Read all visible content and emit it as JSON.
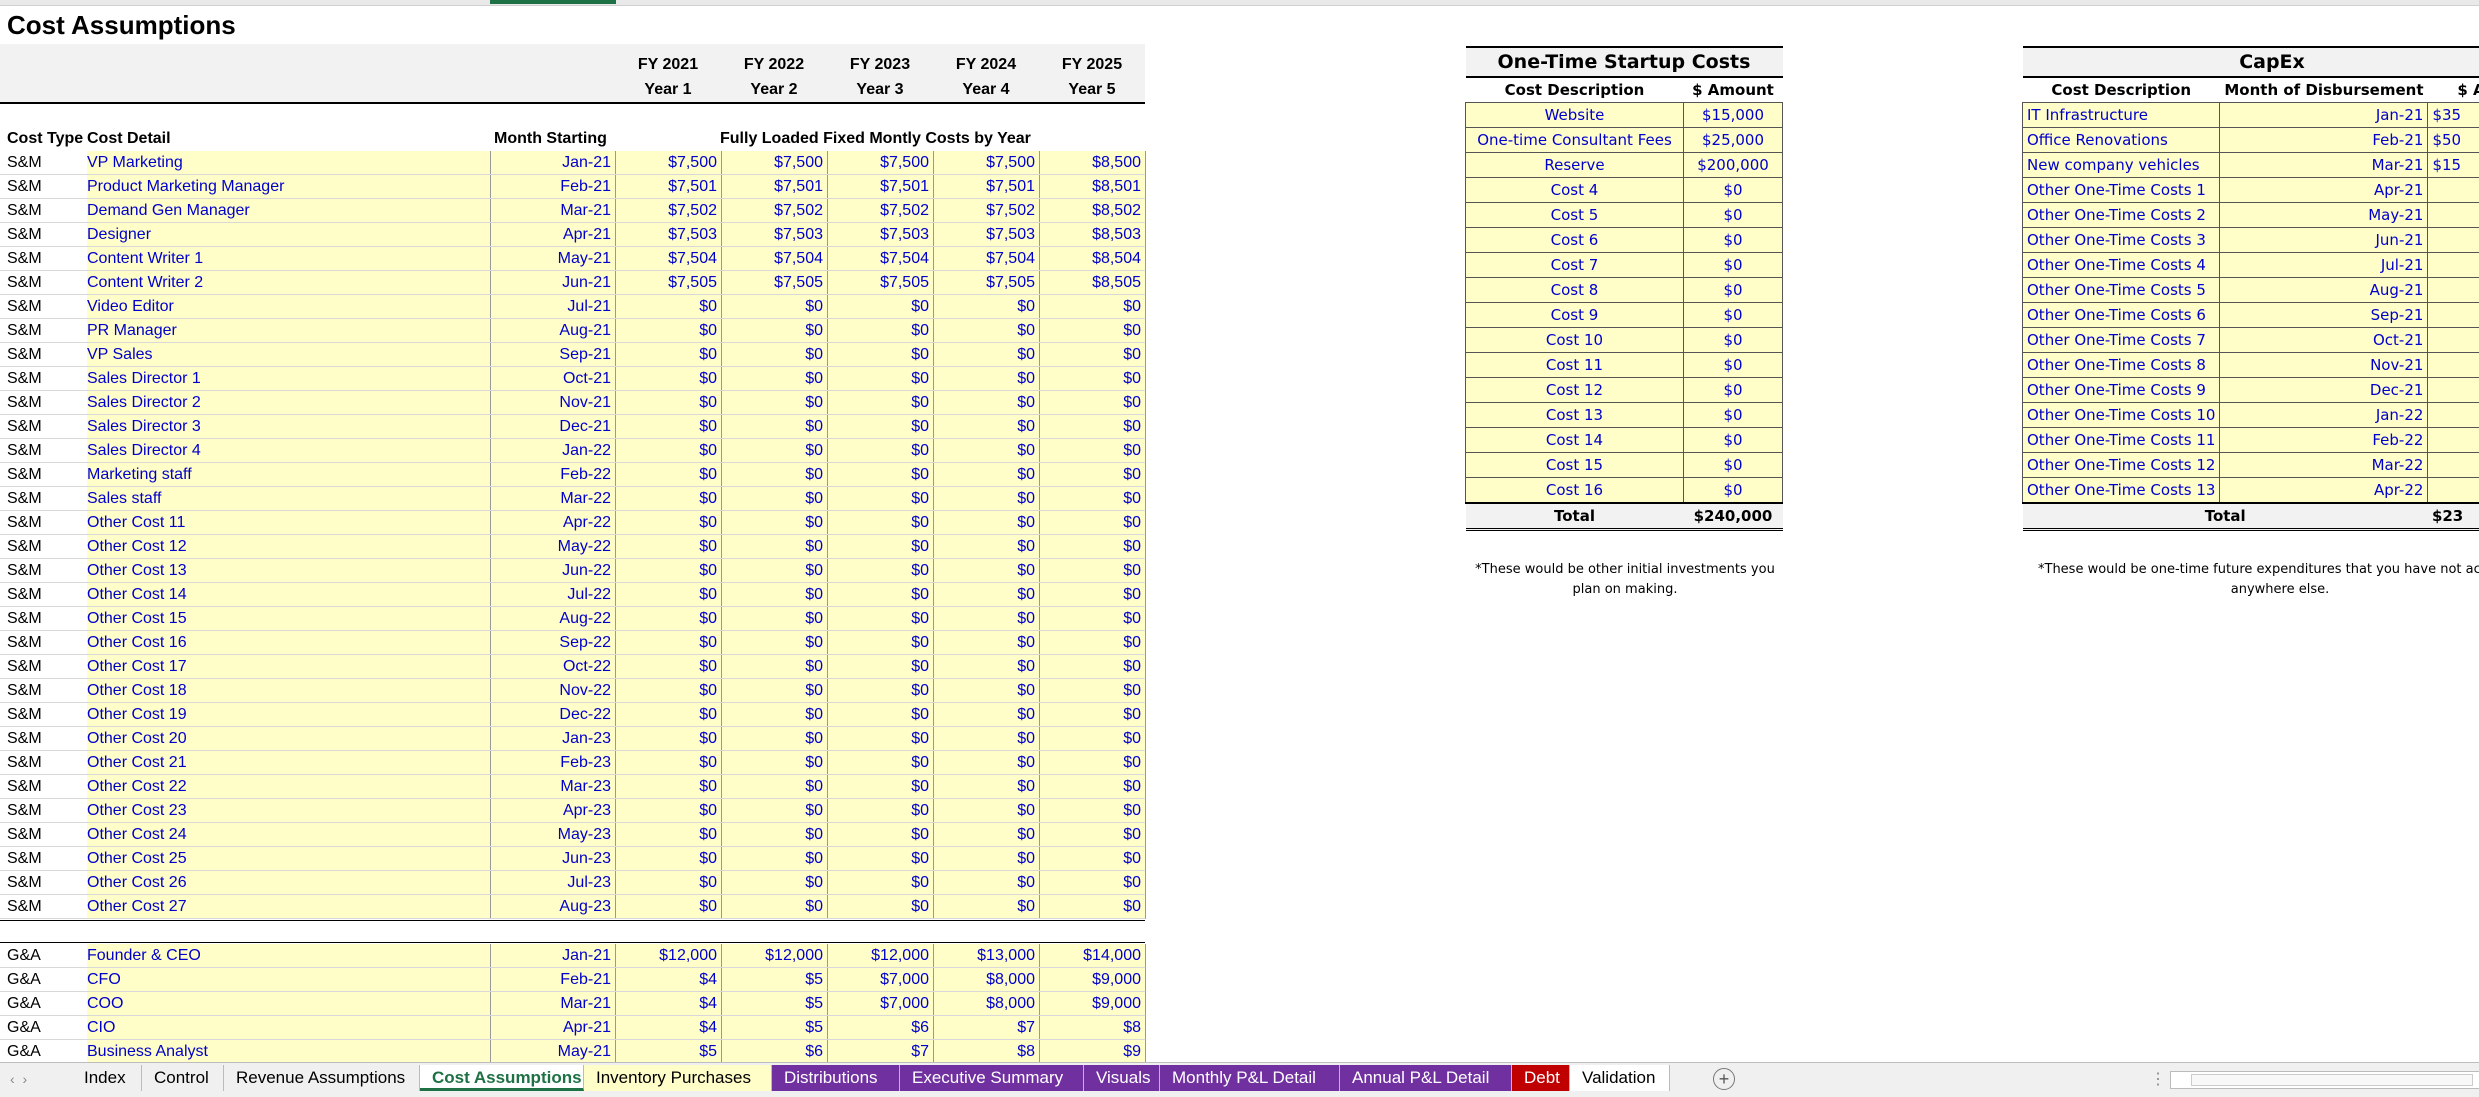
{
  "sheet_title": "Cost Assumptions",
  "fy_headers": [
    {
      "fy": "FY 2021",
      "year": "Year 1"
    },
    {
      "fy": "FY 2022",
      "year": "Year 2"
    },
    {
      "fy": "FY 2023",
      "year": "Year 3"
    },
    {
      "fy": "FY 2024",
      "year": "Year 4"
    },
    {
      "fy": "FY 2025",
      "year": "Year 5"
    }
  ],
  "column_headers": {
    "cost_type": "Cost Type",
    "cost_detail": "Cost Detail",
    "month_starting": "Month Starting",
    "fixed_costs": "Fully Loaded Fixed Montly Costs by Year"
  },
  "sm_rows": [
    {
      "type": "S&M",
      "detail": "VP Marketing",
      "month": "Jan-21",
      "values": [
        "$7,500",
        "$7,500",
        "$7,500",
        "$7,500",
        "$8,500"
      ]
    },
    {
      "type": "S&M",
      "detail": "Product Marketing Manager",
      "month": "Feb-21",
      "values": [
        "$7,501",
        "$7,501",
        "$7,501",
        "$7,501",
        "$8,501"
      ]
    },
    {
      "type": "S&M",
      "detail": "Demand Gen Manager",
      "month": "Mar-21",
      "values": [
        "$7,502",
        "$7,502",
        "$7,502",
        "$7,502",
        "$8,502"
      ]
    },
    {
      "type": "S&M",
      "detail": "Designer",
      "month": "Apr-21",
      "values": [
        "$7,503",
        "$7,503",
        "$7,503",
        "$7,503",
        "$8,503"
      ]
    },
    {
      "type": "S&M",
      "detail": "Content Writer 1",
      "month": "May-21",
      "values": [
        "$7,504",
        "$7,504",
        "$7,504",
        "$7,504",
        "$8,504"
      ]
    },
    {
      "type": "S&M",
      "detail": "Content Writer 2",
      "month": "Jun-21",
      "values": [
        "$7,505",
        "$7,505",
        "$7,505",
        "$7,505",
        "$8,505"
      ]
    },
    {
      "type": "S&M",
      "detail": "Video Editor",
      "month": "Jul-21",
      "values": [
        "$0",
        "$0",
        "$0",
        "$0",
        "$0"
      ]
    },
    {
      "type": "S&M",
      "detail": "PR Manager",
      "month": "Aug-21",
      "values": [
        "$0",
        "$0",
        "$0",
        "$0",
        "$0"
      ]
    },
    {
      "type": "S&M",
      "detail": "VP Sales",
      "month": "Sep-21",
      "values": [
        "$0",
        "$0",
        "$0",
        "$0",
        "$0"
      ]
    },
    {
      "type": "S&M",
      "detail": "Sales Director 1",
      "month": "Oct-21",
      "values": [
        "$0",
        "$0",
        "$0",
        "$0",
        "$0"
      ]
    },
    {
      "type": "S&M",
      "detail": "Sales Director 2",
      "month": "Nov-21",
      "values": [
        "$0",
        "$0",
        "$0",
        "$0",
        "$0"
      ]
    },
    {
      "type": "S&M",
      "detail": "Sales Director 3",
      "month": "Dec-21",
      "values": [
        "$0",
        "$0",
        "$0",
        "$0",
        "$0"
      ]
    },
    {
      "type": "S&M",
      "detail": "Sales Director 4",
      "month": "Jan-22",
      "values": [
        "$0",
        "$0",
        "$0",
        "$0",
        "$0"
      ]
    },
    {
      "type": "S&M",
      "detail": "Marketing staff",
      "month": "Feb-22",
      "values": [
        "$0",
        "$0",
        "$0",
        "$0",
        "$0"
      ]
    },
    {
      "type": "S&M",
      "detail": "Sales staff",
      "month": "Mar-22",
      "values": [
        "$0",
        "$0",
        "$0",
        "$0",
        "$0"
      ]
    },
    {
      "type": "S&M",
      "detail": "Other Cost 11",
      "month": "Apr-22",
      "values": [
        "$0",
        "$0",
        "$0",
        "$0",
        "$0"
      ]
    },
    {
      "type": "S&M",
      "detail": "Other Cost 12",
      "month": "May-22",
      "values": [
        "$0",
        "$0",
        "$0",
        "$0",
        "$0"
      ]
    },
    {
      "type": "S&M",
      "detail": "Other Cost 13",
      "month": "Jun-22",
      "values": [
        "$0",
        "$0",
        "$0",
        "$0",
        "$0"
      ]
    },
    {
      "type": "S&M",
      "detail": "Other Cost 14",
      "month": "Jul-22",
      "values": [
        "$0",
        "$0",
        "$0",
        "$0",
        "$0"
      ]
    },
    {
      "type": "S&M",
      "detail": "Other Cost 15",
      "month": "Aug-22",
      "values": [
        "$0",
        "$0",
        "$0",
        "$0",
        "$0"
      ]
    },
    {
      "type": "S&M",
      "detail": "Other Cost 16",
      "month": "Sep-22",
      "values": [
        "$0",
        "$0",
        "$0",
        "$0",
        "$0"
      ]
    },
    {
      "type": "S&M",
      "detail": "Other Cost 17",
      "month": "Oct-22",
      "values": [
        "$0",
        "$0",
        "$0",
        "$0",
        "$0"
      ]
    },
    {
      "type": "S&M",
      "detail": "Other Cost 18",
      "month": "Nov-22",
      "values": [
        "$0",
        "$0",
        "$0",
        "$0",
        "$0"
      ]
    },
    {
      "type": "S&M",
      "detail": "Other Cost 19",
      "month": "Dec-22",
      "values": [
        "$0",
        "$0",
        "$0",
        "$0",
        "$0"
      ]
    },
    {
      "type": "S&M",
      "detail": "Other Cost 20",
      "month": "Jan-23",
      "values": [
        "$0",
        "$0",
        "$0",
        "$0",
        "$0"
      ]
    },
    {
      "type": "S&M",
      "detail": "Other Cost 21",
      "month": "Feb-23",
      "values": [
        "$0",
        "$0",
        "$0",
        "$0",
        "$0"
      ]
    },
    {
      "type": "S&M",
      "detail": "Other Cost 22",
      "month": "Mar-23",
      "values": [
        "$0",
        "$0",
        "$0",
        "$0",
        "$0"
      ]
    },
    {
      "type": "S&M",
      "detail": "Other Cost 23",
      "month": "Apr-23",
      "values": [
        "$0",
        "$0",
        "$0",
        "$0",
        "$0"
      ]
    },
    {
      "type": "S&M",
      "detail": "Other Cost 24",
      "month": "May-23",
      "values": [
        "$0",
        "$0",
        "$0",
        "$0",
        "$0"
      ]
    },
    {
      "type": "S&M",
      "detail": "Other Cost 25",
      "month": "Jun-23",
      "values": [
        "$0",
        "$0",
        "$0",
        "$0",
        "$0"
      ]
    },
    {
      "type": "S&M",
      "detail": "Other Cost 26",
      "month": "Jul-23",
      "values": [
        "$0",
        "$0",
        "$0",
        "$0",
        "$0"
      ]
    },
    {
      "type": "S&M",
      "detail": "Other Cost 27",
      "month": "Aug-23",
      "values": [
        "$0",
        "$0",
        "$0",
        "$0",
        "$0"
      ]
    }
  ],
  "ga_rows": [
    {
      "type": "G&A",
      "detail": "Founder & CEO",
      "month": "Jan-21",
      "values": [
        "$12,000",
        "$12,000",
        "$12,000",
        "$13,000",
        "$14,000"
      ]
    },
    {
      "type": "G&A",
      "detail": "CFO",
      "month": "Feb-21",
      "values": [
        "$4",
        "$5",
        "$7,000",
        "$8,000",
        "$9,000"
      ]
    },
    {
      "type": "G&A",
      "detail": "COO",
      "month": "Mar-21",
      "values": [
        "$4",
        "$5",
        "$7,000",
        "$8,000",
        "$9,000"
      ]
    },
    {
      "type": "G&A",
      "detail": "CIO",
      "month": "Apr-21",
      "values": [
        "$4",
        "$5",
        "$6",
        "$7",
        "$8"
      ]
    },
    {
      "type": "G&A",
      "detail": "Business Analyst",
      "month": "May-21",
      "values": [
        "$5",
        "$6",
        "$7",
        "$8",
        "$9"
      ]
    }
  ],
  "startup": {
    "title": "One-Time Startup Costs",
    "col_desc": "Cost Description",
    "col_amount": "$ Amount",
    "rows": [
      {
        "desc": "Website",
        "amount": "$15,000"
      },
      {
        "desc": "One-time Consultant Fees",
        "amount": "$25,000"
      },
      {
        "desc": "Reserve",
        "amount": "$200,000"
      },
      {
        "desc": "Cost 4",
        "amount": "$0"
      },
      {
        "desc": "Cost 5",
        "amount": "$0"
      },
      {
        "desc": "Cost 6",
        "amount": "$0"
      },
      {
        "desc": "Cost 7",
        "amount": "$0"
      },
      {
        "desc": "Cost 8",
        "amount": "$0"
      },
      {
        "desc": "Cost 9",
        "amount": "$0"
      },
      {
        "desc": "Cost 10",
        "amount": "$0"
      },
      {
        "desc": "Cost 11",
        "amount": "$0"
      },
      {
        "desc": "Cost 12",
        "amount": "$0"
      },
      {
        "desc": "Cost 13",
        "amount": "$0"
      },
      {
        "desc": "Cost 14",
        "amount": "$0"
      },
      {
        "desc": "Cost 15",
        "amount": "$0"
      },
      {
        "desc": "Cost 16",
        "amount": "$0"
      }
    ],
    "total_label": "Total",
    "total_value": "$240,000",
    "note_line1": "*These would be other initial investments you",
    "note_line2": "plan on making."
  },
  "capex": {
    "title": "CapEx",
    "col_desc": "Cost Description",
    "col_month": "Month of Disbursement",
    "col_amount": "$ Ar",
    "rows": [
      {
        "desc": "IT Infrastructure",
        "month": "Jan-21",
        "amount": "$35"
      },
      {
        "desc": "Office Renovations",
        "month": "Feb-21",
        "amount": "$50"
      },
      {
        "desc": "New company vehicles",
        "month": "Mar-21",
        "amount": "$15"
      },
      {
        "desc": "Other One-Time Costs 1",
        "month": "Apr-21",
        "amount": ""
      },
      {
        "desc": "Other One-Time Costs 2",
        "month": "May-21",
        "amount": ""
      },
      {
        "desc": "Other One-Time Costs 3",
        "month": "Jun-21",
        "amount": ""
      },
      {
        "desc": "Other One-Time Costs 4",
        "month": "Jul-21",
        "amount": ""
      },
      {
        "desc": "Other One-Time Costs 5",
        "month": "Aug-21",
        "amount": ""
      },
      {
        "desc": "Other One-Time Costs 6",
        "month": "Sep-21",
        "amount": ""
      },
      {
        "desc": "Other One-Time Costs 7",
        "month": "Oct-21",
        "amount": ""
      },
      {
        "desc": "Other One-Time Costs 8",
        "month": "Nov-21",
        "amount": ""
      },
      {
        "desc": "Other One-Time Costs 9",
        "month": "Dec-21",
        "amount": ""
      },
      {
        "desc": "Other One-Time Costs 10",
        "month": "Jan-22",
        "amount": ""
      },
      {
        "desc": "Other One-Time Costs 11",
        "month": "Feb-22",
        "amount": ""
      },
      {
        "desc": "Other One-Time Costs 12",
        "month": "Mar-22",
        "amount": ""
      },
      {
        "desc": "Other One-Time Costs 13",
        "month": "Apr-22",
        "amount": ""
      }
    ],
    "total_label": "Total",
    "total_value": "$23",
    "note_line1": "*These would be one-time future expenditures that you have not accou",
    "note_line2": "anywhere else."
  },
  "tabs": [
    {
      "label": "Index",
      "bg": "#f0f0f0",
      "color": "#000000"
    },
    {
      "label": "Control",
      "bg": "#f0f0f0",
      "color": "#000000"
    },
    {
      "label": "Revenue Assumptions",
      "bg": "#f0f0f0",
      "color": "#000000"
    },
    {
      "label": "Cost Assumptions",
      "bg": "#ffffff",
      "color": "#1e7145",
      "active": true
    },
    {
      "label": "Inventory Purchases",
      "bg": "#fffdc8",
      "color": "#000000"
    },
    {
      "label": "Distributions",
      "bg": "#7030a0",
      "color": "#ffffff"
    },
    {
      "label": "Executive Summary",
      "bg": "#7030a0",
      "color": "#ffffff"
    },
    {
      "label": "Visuals",
      "bg": "#7030a0",
      "color": "#ffffff"
    },
    {
      "label": "Monthly P&L Detail",
      "bg": "#7030a0",
      "color": "#ffffff"
    },
    {
      "label": "Annual P&L Detail",
      "bg": "#7030a0",
      "color": "#ffffff"
    },
    {
      "label": "Debt",
      "bg": "#c00000",
      "color": "#ffffff"
    },
    {
      "label": "Validation",
      "bg": "#ffffff",
      "color": "#000000"
    }
  ],
  "add_sheet_icon": "plus-circle-icon",
  "colors": {
    "input_fill": "#fffdc8",
    "input_text": "#0000cc",
    "header_fill": "#f2f2f2",
    "accent": "#1e7145"
  }
}
